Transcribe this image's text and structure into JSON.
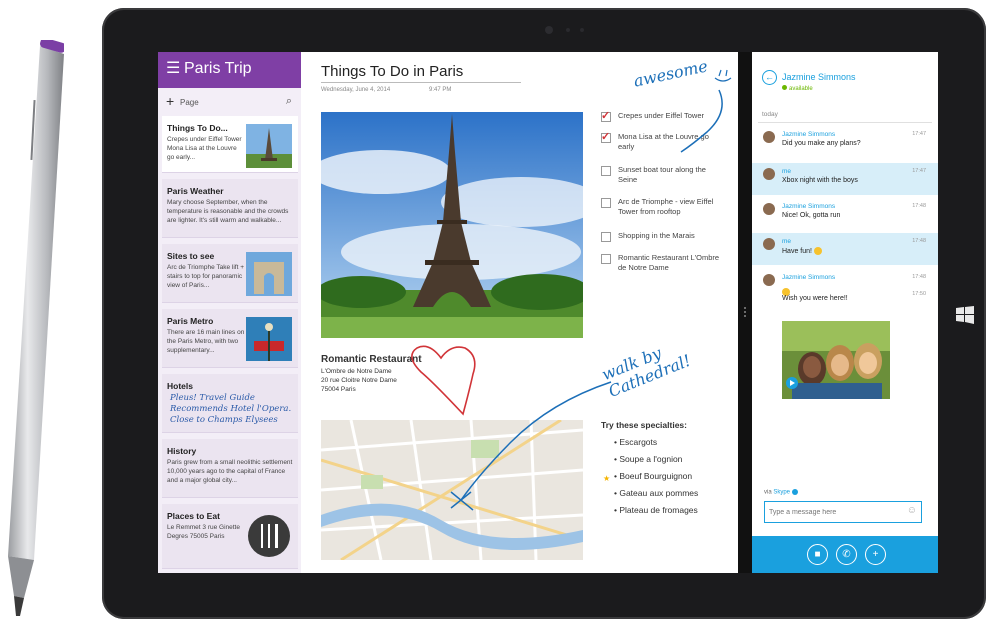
{
  "onenote": {
    "notebook_title": "Paris Trip",
    "add_page_label": "Page",
    "pages": [
      {
        "title": "Things To Do...",
        "text": "Crepes under Eiffel Tower Mona Lisa at the Louvre go early..."
      },
      {
        "title": "Paris Weather",
        "text": "Mary choose September, when the temperature is reasonable and the crowds are lighter. It's still warm and walkable..."
      },
      {
        "title": "Sites to see",
        "text": "Arc de Triomphe Take lift + stairs to top for panoramic view of Paris..."
      },
      {
        "title": "Paris Metro",
        "text": "There are 16 main lines on the Paris Metro, with two supplementary..."
      },
      {
        "title": "Hotels",
        "text": "Pleus! Travel Guide Recommends Hotel l'Opera. Close to Champs Elysees"
      },
      {
        "title": "History",
        "text": "Paris grew from a small neolithic settlement 10,000 years ago to the capital of France and a major global city..."
      },
      {
        "title": "Places to Eat",
        "text": "Le Remmet 3 rue Ginette Degres 75005 Paris"
      }
    ]
  },
  "note": {
    "title": "Things To Do in Paris",
    "date": "Wednesday, June 4, 2014",
    "time": "9:47 PM",
    "todos": [
      {
        "text": "Crepes under Eiffel Tower",
        "checked": true
      },
      {
        "text": "Mona Lisa at the Louvre go early",
        "checked": true
      },
      {
        "text": "Sunset boat tour along the Seine",
        "checked": false
      },
      {
        "text": "Arc de Triomphe - view Eiffel Tower from rooftop",
        "checked": false
      },
      {
        "text": "Shopping in the Marais",
        "checked": false
      },
      {
        "text": "Romantic Restaurant L'Ombre de Notre Dame",
        "checked": false
      }
    ],
    "restaurant": {
      "title": "Romantic Restaurant",
      "name": "L'Ombre de Notre Dame",
      "street": "20 rue Cloitre Notre Dame",
      "city": "75004 Paris"
    },
    "specialties_title": "Try these specialties:",
    "specialties": [
      "Escargots",
      "Soupe a l'ognion",
      "Boeuf Bourguignon",
      "Gateau aux pommes",
      "Plateau de fromages"
    ],
    "ink_awesome": "awesome",
    "ink_walk": "walk by Cathedral!"
  },
  "skype": {
    "contact_name": "Jazmine Simmons",
    "status": "available",
    "day_label": "today",
    "messages": [
      {
        "from": "Jazmine Simmons",
        "text": "Did you make any plans?",
        "time": "17:47"
      },
      {
        "from": "me",
        "text": "Xbox night with the boys",
        "time": "17:47"
      },
      {
        "from": "Jazmine Simmons",
        "text": "Nice! Ok, gotta run",
        "time": "17:48"
      },
      {
        "from": "me",
        "text": "Have fun!",
        "time": "17:48"
      },
      {
        "from": "Jazmine Simmons",
        "text": "Wish you were here!!",
        "time": "17:48",
        "time2": "17:50"
      }
    ],
    "via_label": "via",
    "via_service": "Skype",
    "input_placeholder": "Type a message here"
  },
  "colors": {
    "onenote_purple": "#7f3fa5",
    "skype_blue": "#1aa0de",
    "ink_blue": "#1c6fb8",
    "ink_red": "#d13438"
  }
}
